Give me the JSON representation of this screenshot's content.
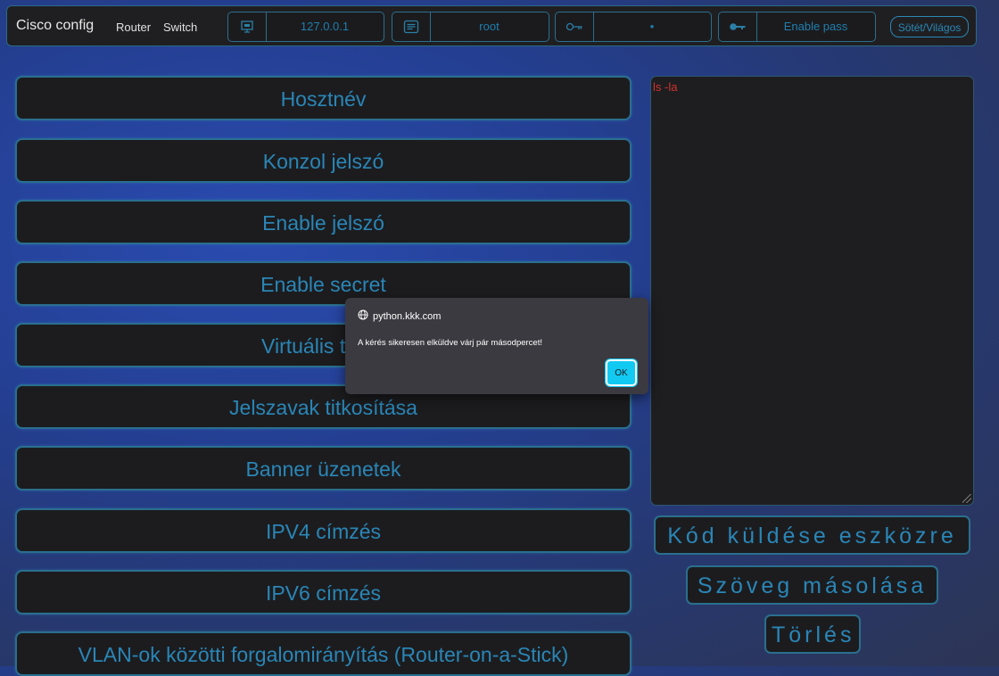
{
  "navbar": {
    "brand": "Cisco config",
    "links": [
      "Router",
      "Switch"
    ],
    "fields": [
      {
        "icon": "monitor-icon",
        "value": "127.0.0.1"
      },
      {
        "icon": "document-icon",
        "value": "root"
      },
      {
        "icon": "key-outline-icon",
        "value": "•"
      },
      {
        "icon": "key-solid-icon",
        "value": "Enable pass"
      }
    ],
    "theme_label": "Sötét/Világos"
  },
  "config_buttons": [
    "Hosztnév",
    "Konzol jelszó",
    "Enable jelszó",
    "Enable secret",
    "Virtuális termi",
    "Jelszavak titkosítása",
    "Banner üzenetek",
    "IPV4 címzés",
    "IPV6 címzés",
    "VLAN-ok közötti forgalomirányítás (Router-on-a-Stick)"
  ],
  "editor": {
    "value": "ls -la"
  },
  "actions": {
    "send": "Kód küldése eszközre",
    "copy": "Szöveg másolása",
    "clear": "Törlés"
  },
  "dialog": {
    "origin": "python.kkk.com",
    "message": "A kérés sikeresen elküldve várj pár másodpercet!",
    "ok_label": "OK"
  },
  "colors": {
    "accent": "#2a86b6",
    "ok_button": "#12c9f2",
    "panel": "#1c1c1f"
  }
}
